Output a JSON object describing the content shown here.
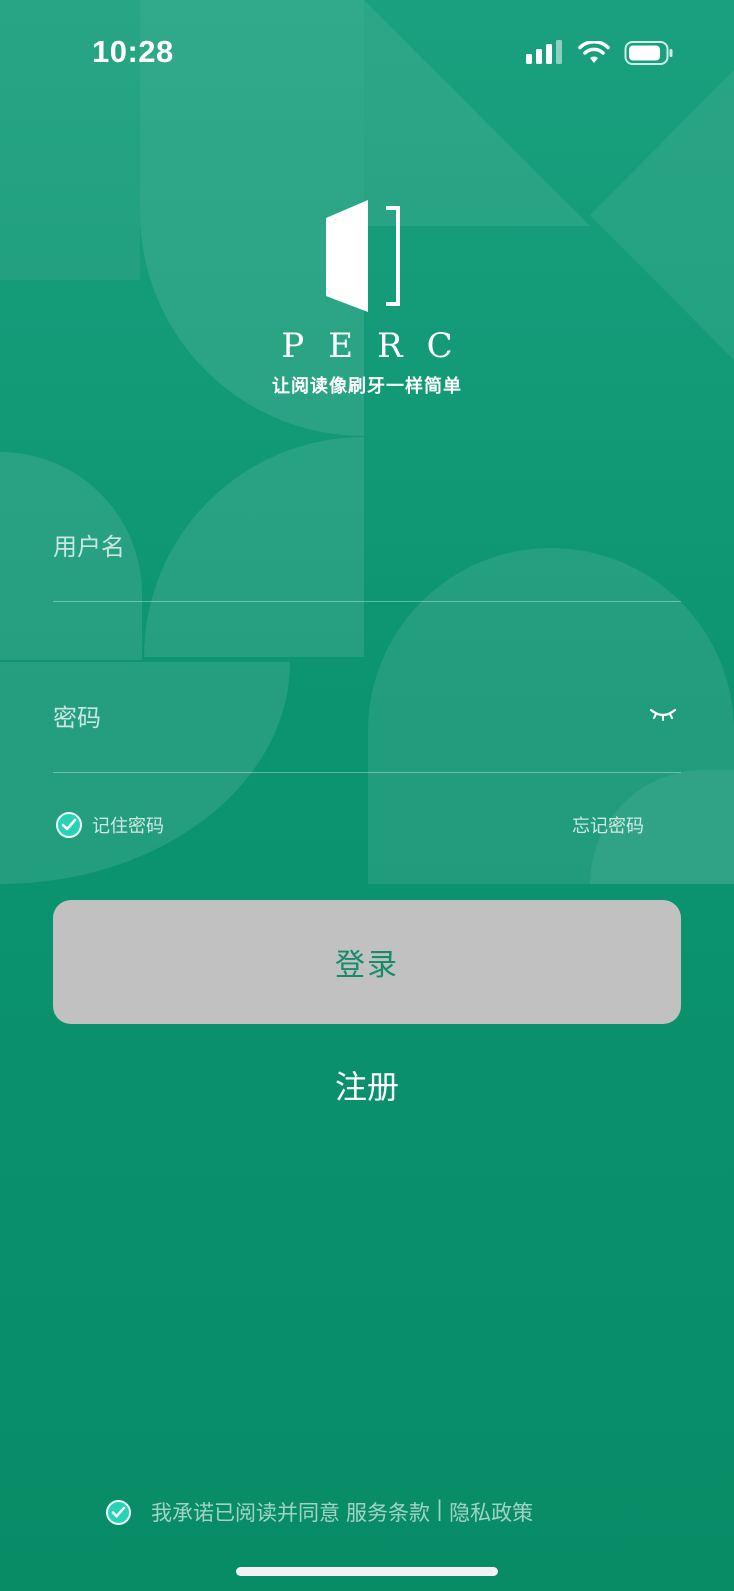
{
  "status": {
    "time": "10:28"
  },
  "logo": {
    "wordmark": "PERC",
    "slogan": "让阅读像刷牙一样简单"
  },
  "form": {
    "username_placeholder": "用户名",
    "password_placeholder": "密码",
    "remember_label": "记住密码",
    "forgot_label": "忘记密码",
    "login_label": "登录",
    "register_label": "注册"
  },
  "agreement": {
    "prefix": "我承诺已阅读并同意",
    "terms": "服务条款",
    "separator": "|",
    "privacy": "隐私政策"
  },
  "icons": {
    "eye": "eye-closed-icon",
    "check": "checkmark-icon",
    "signal": "cellular-signal-icon",
    "wifi": "wifi-icon",
    "battery": "battery-icon"
  },
  "colors": {
    "background": "#0a8f6a",
    "check": "#2ad1b6",
    "button": "#c1c1c1",
    "button_text": "#168c6b"
  }
}
